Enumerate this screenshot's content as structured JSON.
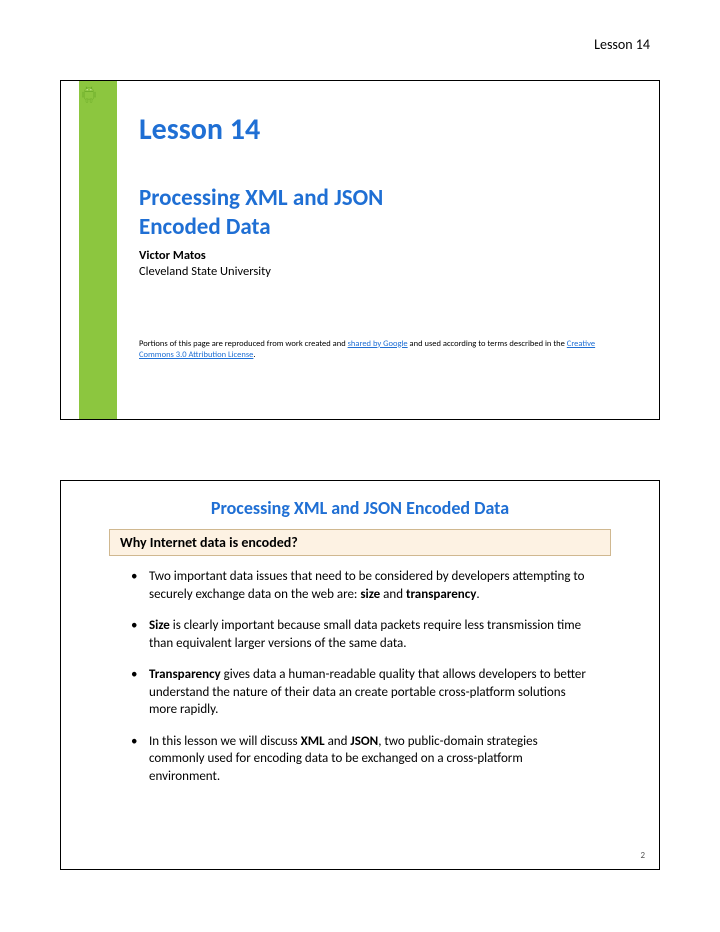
{
  "header": {
    "label": "Lesson 14"
  },
  "slide1": {
    "lesson_title": "Lesson 14",
    "subtitle_line1": "Processing XML and JSON",
    "subtitle_line2": "Encoded Data",
    "author": "Victor Matos",
    "university": "Cleveland State University",
    "attr_prefix": "Portions of this page are reproduced from work created and ",
    "attr_link1": "shared by Google",
    "attr_mid": " and used according to terms described in the ",
    "attr_link2": "Creative Commons 3.0 Attribution License",
    "attr_suffix": "."
  },
  "slide2": {
    "title": "Processing XML and JSON Encoded Data",
    "question": "Why Internet data is encoded?",
    "bullets": [
      {
        "pre": "Two important data issues that need to be considered by developers attempting to securely exchange data on the web are: ",
        "b1": "size",
        "mid": " and ",
        "b2": "transparency",
        "post": "."
      },
      {
        "b1": "Size",
        "post": " is clearly important because small data packets require less transmission time than equivalent larger versions of the same data."
      },
      {
        "b1": "Transparency",
        "post": " gives data a human-readable quality that allows developers to better understand the nature of their data an create portable cross-platform solutions more rapidly."
      },
      {
        "pre": "In this lesson we will discuss ",
        "b1": "XML",
        "mid": " and ",
        "b2": "JSON",
        "post": ", two public-domain strategies commonly used for encoding data to be exchanged on a cross-platform environment."
      }
    ],
    "page_number": "2"
  }
}
